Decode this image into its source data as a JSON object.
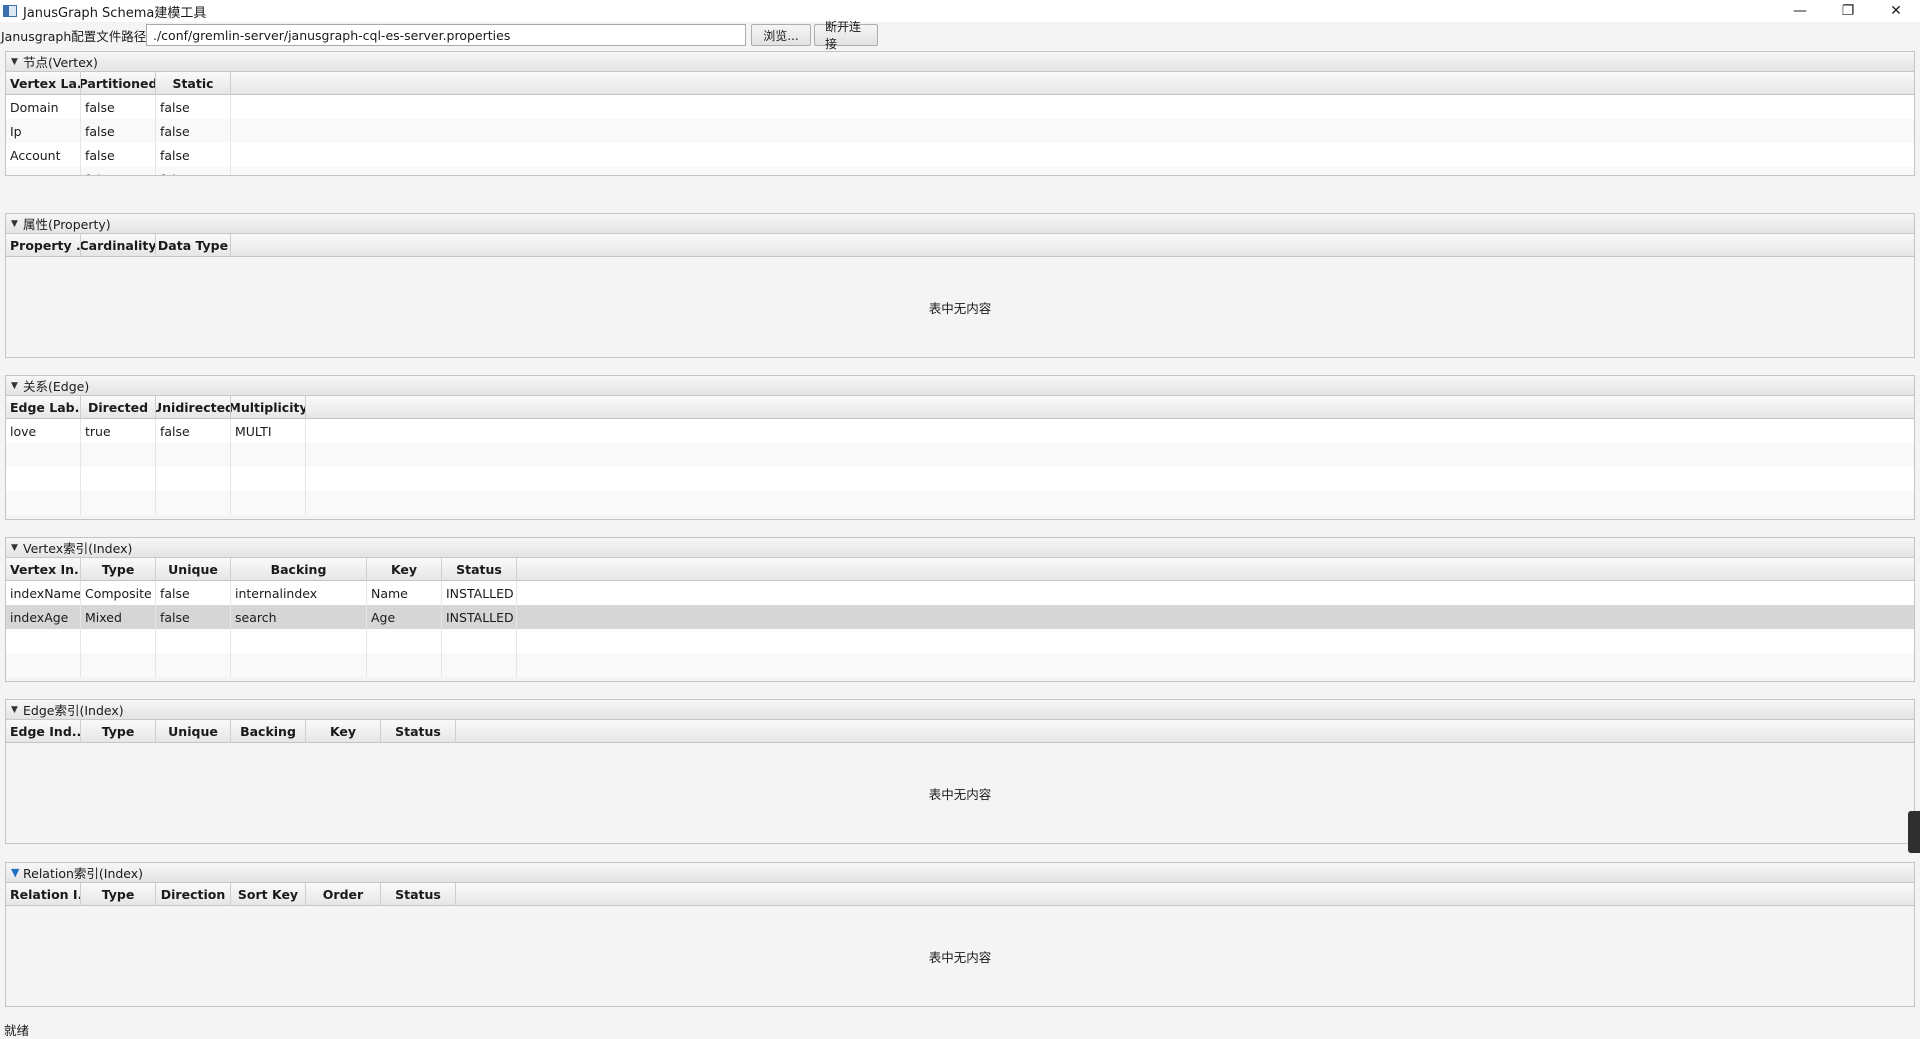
{
  "window": {
    "title": "JanusGraph Schema建模工具",
    "minimize": "—",
    "maximize": "❐",
    "close": "✕"
  },
  "config": {
    "label": "Janusgraph配置文件路径:",
    "path": "./conf/gremlin-server/janusgraph-cql-es-server.properties",
    "browse_label": "浏览...",
    "disconnect_label": "断开连接"
  },
  "empty_text": "表中无内容",
  "vertex": {
    "title": "节点(Vertex)",
    "columns": [
      "Vertex La...",
      "Partitioned",
      "Static"
    ],
    "rows": [
      [
        "Domain",
        "false",
        "false"
      ],
      [
        "Ip",
        "false",
        "false"
      ],
      [
        "Account",
        "false",
        "false"
      ],
      [
        "Person",
        "false",
        "false"
      ]
    ]
  },
  "property": {
    "title": "属性(Property)",
    "columns": [
      "Property ...",
      "Cardinality",
      "Data Type"
    ],
    "rows": []
  },
  "edge": {
    "title": "关系(Edge)",
    "columns": [
      "Edge Lab...",
      "Directed",
      "Unidirected",
      "Multiplicity"
    ],
    "rows": [
      [
        "love",
        "true",
        "false",
        "MULTI"
      ]
    ]
  },
  "vertex_index": {
    "title": "Vertex索引(Index)",
    "columns": [
      "Vertex In...",
      "Type",
      "Unique",
      "Backing",
      "Key",
      "Status"
    ],
    "rows": [
      [
        "indexName",
        "Composite",
        "false",
        "internalindex",
        "Name",
        "INSTALLED"
      ],
      [
        "indexAge",
        "Mixed",
        "false",
        "search",
        "Age",
        "INSTALLED"
      ]
    ],
    "selected_row": 1
  },
  "edge_index": {
    "title": "Edge索引(Index)",
    "columns": [
      "Edge Ind...",
      "Type",
      "Unique",
      "Backing",
      "Key",
      "Status"
    ],
    "rows": []
  },
  "relation_index": {
    "title": "Relation索引(Index)",
    "columns": [
      "Relation I...",
      "Type",
      "Direction",
      "Sort Key",
      "Order",
      "Status"
    ],
    "rows": []
  },
  "status": "就绪"
}
